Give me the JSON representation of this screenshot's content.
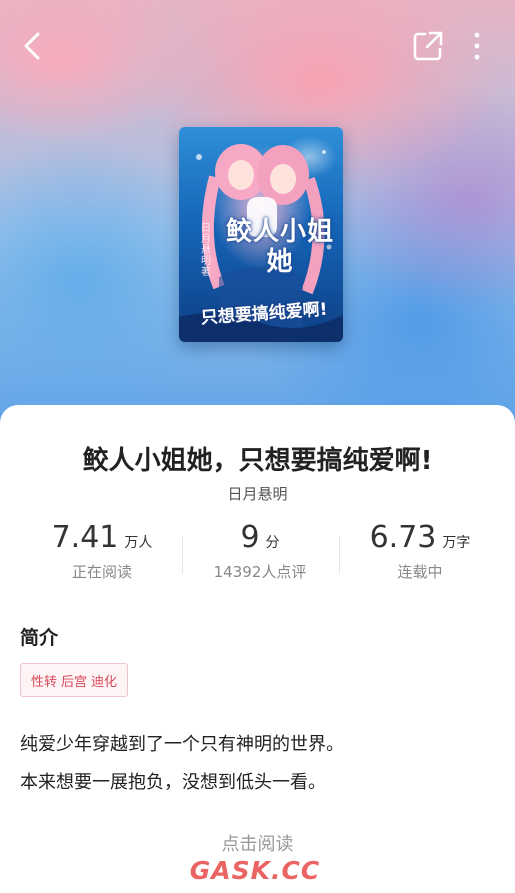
{
  "header": {
    "back_icon": "chevron-left-icon",
    "share_icon": "share-icon",
    "more_icon": "more-vertical-icon"
  },
  "cover": {
    "title_line1": "鲛人小姐她",
    "title_line2": "只想要搞纯爱啊!",
    "author": "日月悬明·著"
  },
  "book": {
    "title": "鲛人小姐她，只想要搞纯爱啊!",
    "author": "日月悬明"
  },
  "stats": [
    {
      "value": "7.41",
      "unit": "万人",
      "label": "正在阅读"
    },
    {
      "value": "9",
      "unit": "分",
      "label": "14392人点评"
    },
    {
      "value": "6.73",
      "unit": "万字",
      "label": "连载中"
    }
  ],
  "intro": {
    "title": "简介",
    "tags": [
      "性转",
      "后宫",
      "迪化"
    ],
    "lines": [
      "纯爱少年穿越到了一个只有神明的世界。",
      "本来想要一展抱负，没想到低头一看。"
    ]
  },
  "actions": {
    "read_label": "点击阅读"
  },
  "watermark": "GASK.CC",
  "colors": {
    "tag_text": "#d44a5a",
    "tag_border": "#f2c3c8",
    "watermark": "#e84a4a"
  }
}
